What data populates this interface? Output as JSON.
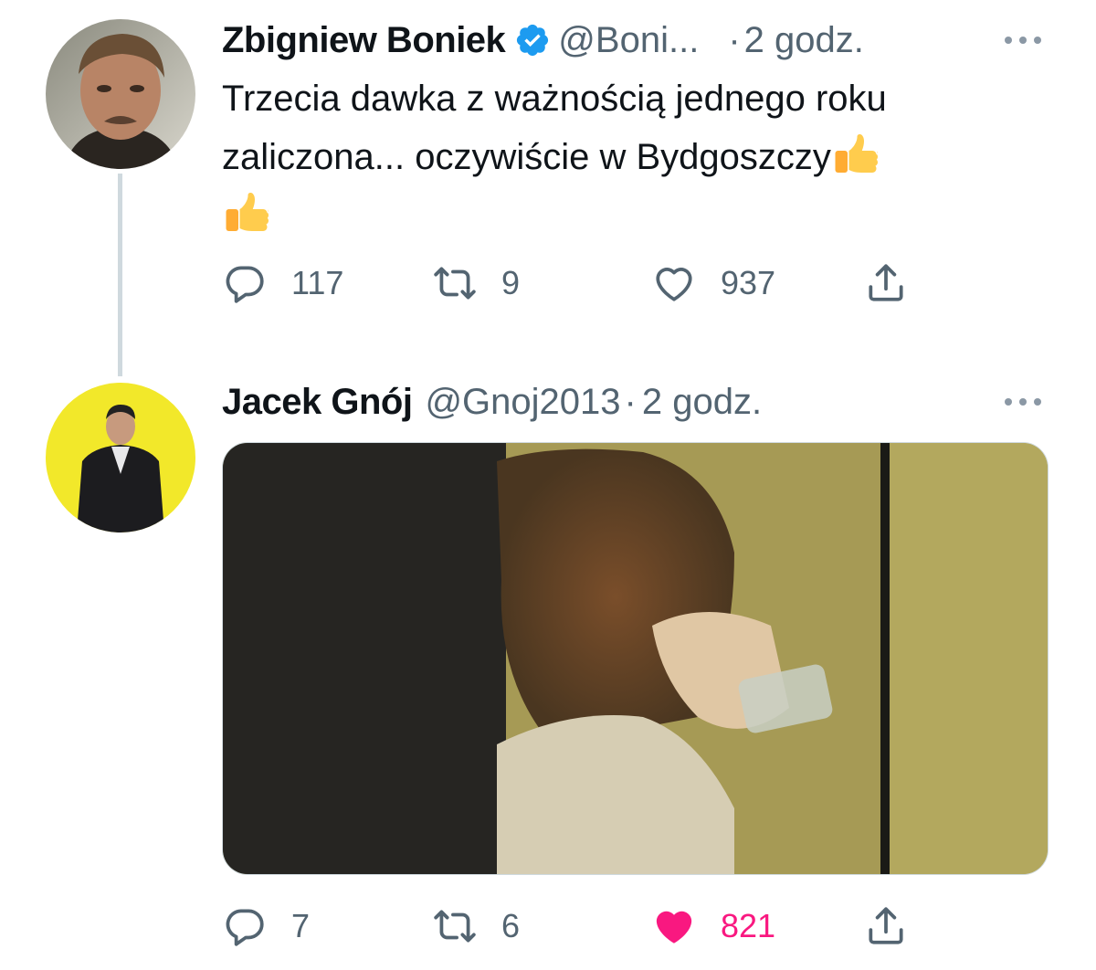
{
  "tweets": [
    {
      "author": "Zbigniew Boniek",
      "verified": true,
      "handle": "@Boni...",
      "separator": "·",
      "time": "2 godz.",
      "text": "Trzecia dawka z ważnością jednego roku zaliczona... oczywiście w Bydgoszczy",
      "emoji": [
        "thumbs-up",
        "thumbs-up"
      ],
      "counts": {
        "replies": "117",
        "retweets": "9",
        "likes": "937"
      },
      "liked": false
    },
    {
      "author": "Jacek Gnój",
      "verified": false,
      "handle": "@Gnoj2013",
      "separator": "·",
      "time": "2 godz.",
      "media": "photo",
      "counts": {
        "replies": "7",
        "retweets": "6",
        "likes": "821"
      },
      "liked": true
    }
  ],
  "icons": [
    "verified-badge-icon",
    "more-icon",
    "reply-icon",
    "retweet-icon",
    "like-icon",
    "share-icon",
    "thumbs-up-emoji"
  ],
  "colors": {
    "verified": "#1d9bf0",
    "muted": "#536471",
    "like_active": "#f91880",
    "thread_line": "#cfd9de",
    "avatar2_bg": "#f2e82a"
  }
}
